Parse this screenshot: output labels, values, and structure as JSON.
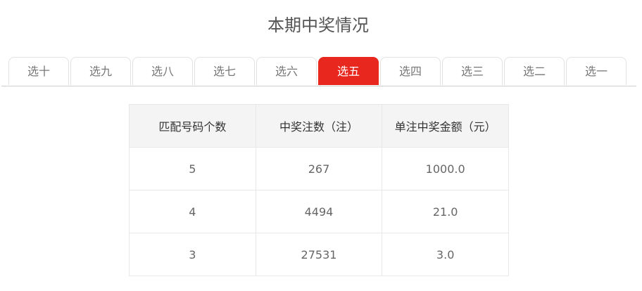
{
  "title": "本期中奖情况",
  "tabs": [
    "选十",
    "选九",
    "选八",
    "选七",
    "选六",
    "选五",
    "选四",
    "选三",
    "选二",
    "选一"
  ],
  "active_tab": "选五",
  "colors": {
    "accent": "#e8281f"
  },
  "table": {
    "headers": [
      "匹配号码个数",
      "中奖注数（注）",
      "单注中奖金额（元）"
    ],
    "rows": [
      [
        "5",
        "267",
        "1000.0"
      ],
      [
        "4",
        "4494",
        "21.0"
      ],
      [
        "3",
        "27531",
        "3.0"
      ]
    ]
  }
}
